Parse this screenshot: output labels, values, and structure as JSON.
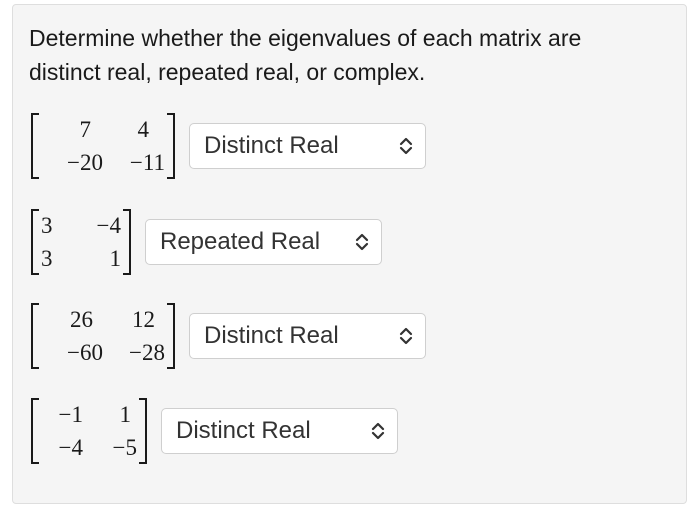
{
  "prompt": "Determine whether the eigenvalues of each matrix are distinct real, repeated real, or complex.",
  "matrices": [
    {
      "cells": [
        "7",
        "4",
        "−20",
        "−11"
      ],
      "answer": "Distinct Real"
    },
    {
      "cells": [
        "3",
        "−4",
        "3",
        "1"
      ],
      "answer": "Repeated Real"
    },
    {
      "cells": [
        "26",
        "12",
        "−60",
        "−28"
      ],
      "answer": "Distinct Real"
    },
    {
      "cells": [
        "−1",
        "1",
        "−4",
        "−5"
      ],
      "answer": "Distinct Real"
    }
  ],
  "icons": {
    "select_arrow": "up-down-chevron-icon"
  }
}
